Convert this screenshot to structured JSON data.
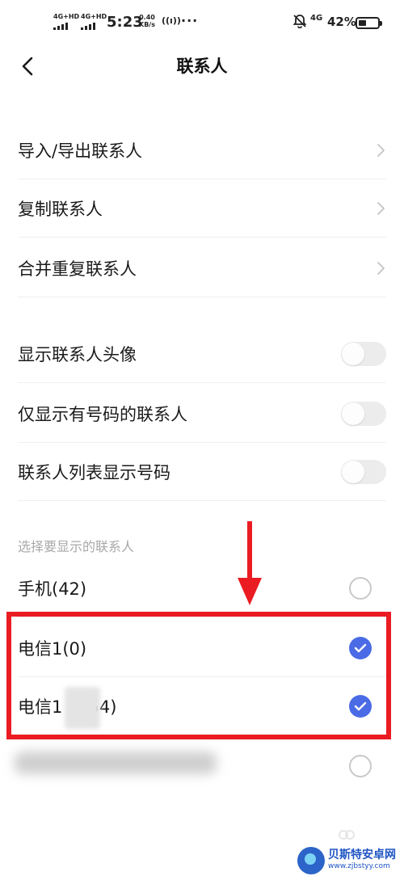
{
  "status_bar": {
    "sim1": "4G+HD",
    "sim2": "4G+HD",
    "time": "5:23",
    "net_speed_value": "0.40",
    "net_speed_unit": "KB/s",
    "hotspot": "((ı))",
    "overflow": "···",
    "data_type": "4G",
    "battery_percent": "42%",
    "battery_level": 0.42
  },
  "header": {
    "title": "联系人",
    "back_icon": "chevron-left-icon"
  },
  "menu_items": [
    {
      "label": "导入/导出联系人",
      "icon": "chevron-right-icon"
    },
    {
      "label": "复制联系人",
      "icon": "chevron-right-icon"
    },
    {
      "label": "合并重复联系人",
      "icon": "chevron-right-icon"
    }
  ],
  "toggles": [
    {
      "label": "显示联系人头像",
      "on": false
    },
    {
      "label": "仅显示有号码的联系人",
      "on": false
    },
    {
      "label": "联系人列表显示号码",
      "on": false
    }
  ],
  "accounts_section": {
    "header": "选择要显示的联系人",
    "items": [
      {
        "label": "手机(42)",
        "checked": false
      },
      {
        "label": "电信1(0)",
        "checked": true
      },
      {
        "label_prefix": "电信1",
        "label_suffix": "(54)",
        "checked": true
      },
      {
        "label": "",
        "checked": false
      }
    ]
  },
  "colors": {
    "accent": "#4a6be5",
    "highlight": "#ea1c22",
    "section_header": "#a9a9a9",
    "watermark": "#1f54c3"
  },
  "watermark": {
    "title": "贝斯特安卓网",
    "url": "www.zjbstyy.com"
  }
}
